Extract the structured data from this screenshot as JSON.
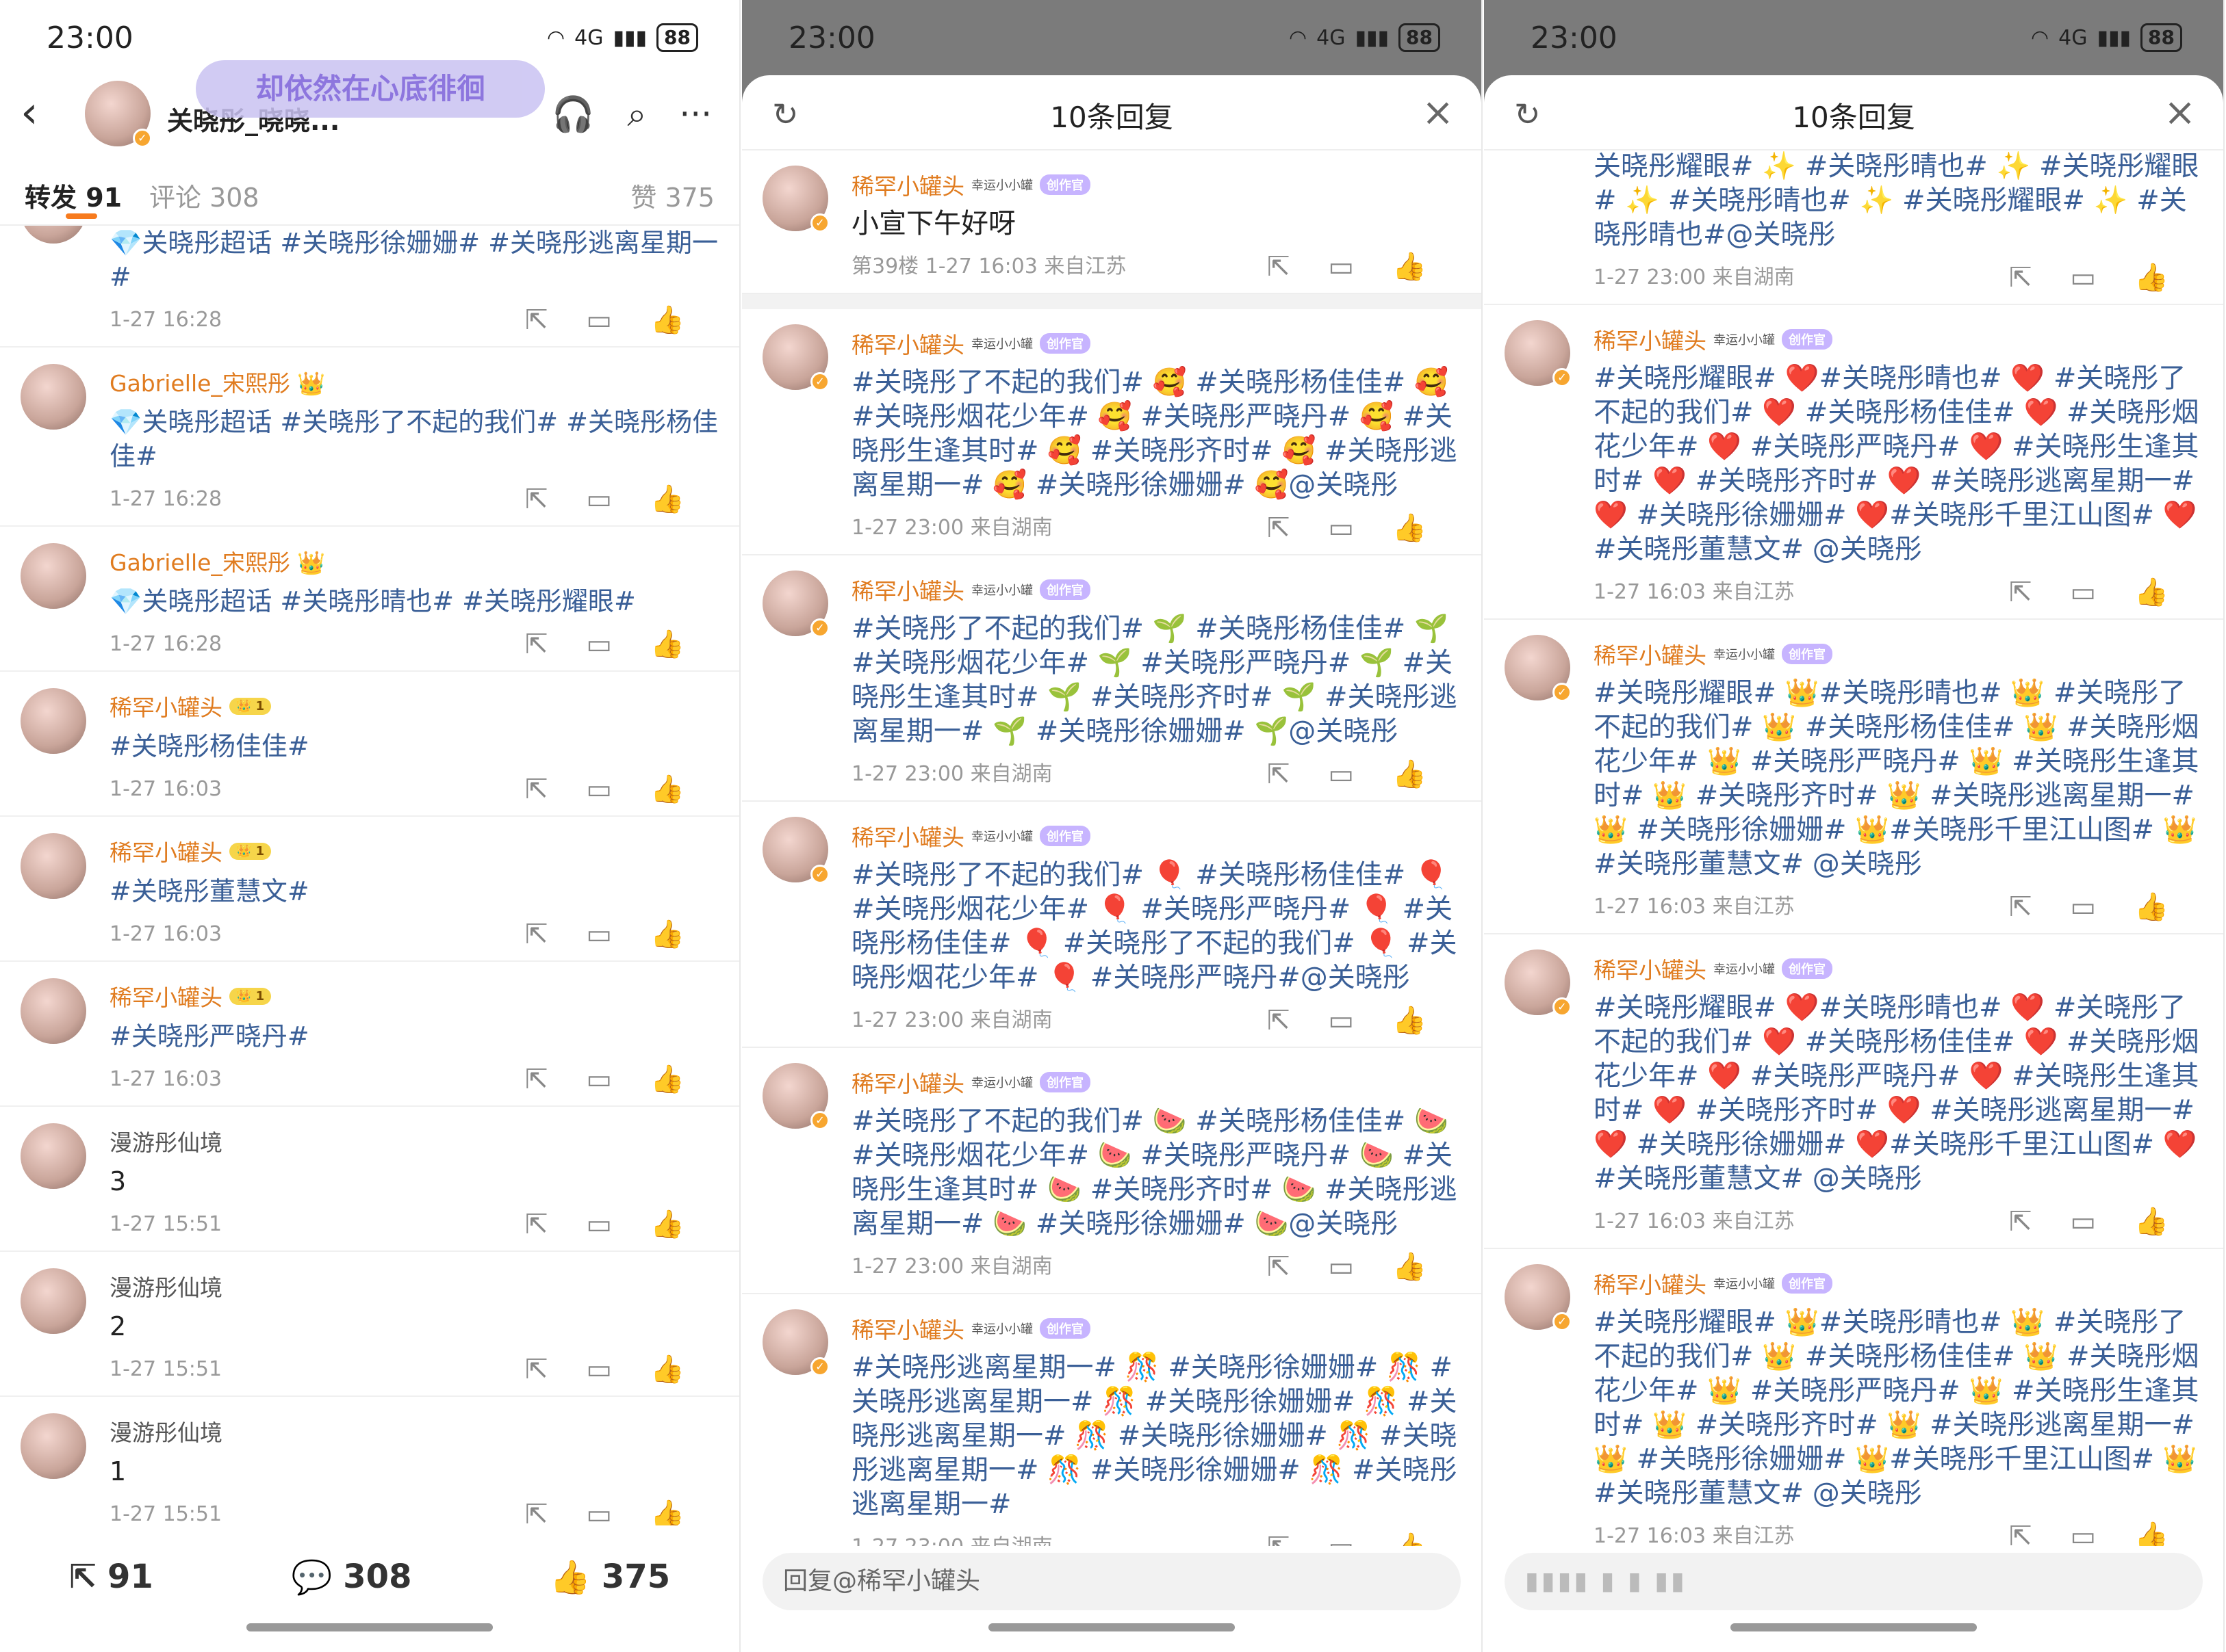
{
  "status": {
    "time": "23:00",
    "network": "4G",
    "battery": "88"
  },
  "panel1": {
    "user_name": "关晓彤_晓晓...",
    "song": "却依然在心底徘徊",
    "tabs": [
      {
        "label": "转发 91"
      },
      {
        "label": "评论 308"
      },
      {
        "label": "赞 375"
      }
    ],
    "items": [
      {
        "name": "",
        "text": "💎关晓彤超话 #关晓彤徐姗姗# #关晓彤逃离星期一#",
        "time": "1-27 16:28"
      },
      {
        "name": "Gabrielle_宋熙彤 👑",
        "text": "💎关晓彤超话 #关晓彤了不起的我们# #关晓彤杨佳佳#",
        "time": "1-27 16:28"
      },
      {
        "name": "Gabrielle_宋熙彤 👑",
        "text": "💎关晓彤超话 #关晓彤晴也# #关晓彤耀眼#",
        "time": "1-27 16:28"
      },
      {
        "name": "稀罕小罐头",
        "text": "#关晓彤杨佳佳#",
        "time": "1-27 16:03"
      },
      {
        "name": "稀罕小罐头",
        "text": "#关晓彤董慧文#",
        "time": "1-27 16:03"
      },
      {
        "name": "稀罕小罐头",
        "text": "#关晓彤严晓丹#",
        "time": "1-27 16:03"
      },
      {
        "name": "漫游彤仙境",
        "text": "3",
        "time": "1-27 15:51"
      },
      {
        "name": "漫游彤仙境",
        "text": "2",
        "time": "1-27 15:51"
      },
      {
        "name": "漫游彤仙境",
        "text": "1",
        "time": "1-27 15:51"
      }
    ],
    "bottom": {
      "repost": "91",
      "comment": "308",
      "like": "375"
    }
  },
  "panel2": {
    "title": "10条回复",
    "badge_lucky": "幸运小小罐",
    "badge_creator": "创作官",
    "first": {
      "name": "稀罕小罐头",
      "text": "小宣下午好呀",
      "meta": "第39楼 1-27 16:03 来自江苏"
    },
    "replies": [
      {
        "name": "稀罕小罐头",
        "text": "#关晓彤了不起的我们# 🥰 #关晓彤杨佳佳# 🥰 #关晓彤烟花少年# 🥰 #关晓彤严晓丹# 🥰 #关晓彤生逢其时# 🥰 #关晓彤齐时# 🥰 #关晓彤逃离星期一# 🥰 #关晓彤徐姗姗# 🥰@关晓彤",
        "meta": "1-27 23:00 来自湖南"
      },
      {
        "name": "稀罕小罐头",
        "text": "#关晓彤了不起的我们# 🌱 #关晓彤杨佳佳# 🌱 #关晓彤烟花少年# 🌱 #关晓彤严晓丹# 🌱 #关晓彤生逢其时# 🌱 #关晓彤齐时# 🌱 #关晓彤逃离星期一# 🌱 #关晓彤徐姗姗# 🌱@关晓彤",
        "meta": "1-27 23:00 来自湖南"
      },
      {
        "name": "稀罕小罐头",
        "text": "#关晓彤了不起的我们# 🎈 #关晓彤杨佳佳# 🎈 #关晓彤烟花少年# 🎈 #关晓彤严晓丹# 🎈 #关晓彤杨佳佳# 🎈 #关晓彤了不起的我们# 🎈 #关晓彤烟花少年# 🎈 #关晓彤严晓丹#@关晓彤",
        "meta": "1-27 23:00 来自湖南"
      },
      {
        "name": "稀罕小罐头",
        "text": "#关晓彤了不起的我们# 🍉 #关晓彤杨佳佳# 🍉 #关晓彤烟花少年# 🍉 #关晓彤严晓丹# 🍉 #关晓彤生逢其时# 🍉 #关晓彤齐时# 🍉 #关晓彤逃离星期一# 🍉 #关晓彤徐姗姗# 🍉@关晓彤",
        "meta": "1-27 23:00 来自湖南"
      },
      {
        "name": "稀罕小罐头",
        "text": "#关晓彤逃离星期一# 🎊 #关晓彤徐姗姗# 🎊 #关晓彤逃离星期一# 🎊 #关晓彤徐姗姗# 🎊 #关晓彤逃离星期一# 🎊 #关晓彤徐姗姗# 🎊 #关晓彤逃离星期一# 🎊 #关晓彤徐姗姗# 🎊 #关晓彤逃离星期一#",
        "meta": "1-27 23:00 来自湖南"
      }
    ],
    "input": "回复@稀罕小罐头"
  },
  "panel3": {
    "title": "10条回复",
    "top_text": "关晓彤耀眼# ✨ #关晓彤晴也# ✨ #关晓彤耀眼# ✨ #关晓彤晴也# ✨ #关晓彤耀眼# ✨ #关晓彤晴也#@关晓彤",
    "top_meta": "1-27 23:00 来自湖南",
    "replies": [
      {
        "name": "稀罕小罐头",
        "text": "#关晓彤耀眼# ❤️#关晓彤晴也# ❤️ #关晓彤了不起的我们# ❤️ #关晓彤杨佳佳# ❤️ #关晓彤烟花少年# ❤️ #关晓彤严晓丹# ❤️ #关晓彤生逢其时# ❤️ #关晓彤齐时# ❤️ #关晓彤逃离星期一# ❤️ #关晓彤徐姗姗# ❤️#关晓彤千里江山图# ❤️#关晓彤董慧文# @关晓彤",
        "meta": "1-27 16:03 来自江苏"
      },
      {
        "name": "稀罕小罐头",
        "text": "#关晓彤耀眼# 👑#关晓彤晴也# 👑 #关晓彤了不起的我们# 👑 #关晓彤杨佳佳# 👑 #关晓彤烟花少年# 👑 #关晓彤严晓丹# 👑 #关晓彤生逢其时# 👑 #关晓彤齐时# 👑 #关晓彤逃离星期一# 👑 #关晓彤徐姗姗# 👑#关晓彤千里江山图# 👑#关晓彤董慧文# @关晓彤",
        "meta": "1-27 16:03 来自江苏"
      },
      {
        "name": "稀罕小罐头",
        "text": "#关晓彤耀眼# ❤️#关晓彤晴也# ❤️ #关晓彤了不起的我们# ❤️ #关晓彤杨佳佳# ❤️ #关晓彤烟花少年# ❤️ #关晓彤严晓丹# ❤️ #关晓彤生逢其时# ❤️ #关晓彤齐时# ❤️ #关晓彤逃离星期一# ❤️ #关晓彤徐姗姗# ❤️#关晓彤千里江山图# ❤️#关晓彤董慧文# @关晓彤",
        "meta": "1-27 16:03 来自江苏"
      },
      {
        "name": "稀罕小罐头",
        "text": "#关晓彤耀眼# 👑#关晓彤晴也# 👑 #关晓彤了不起的我们# 👑 #关晓彤杨佳佳# 👑 #关晓彤烟花少年# 👑 #关晓彤严晓丹# 👑 #关晓彤生逢其时# 👑 #关晓彤齐时# 👑 #关晓彤逃离星期一# 👑 #关晓彤徐姗姗# 👑#关晓彤千里江山图# 👑#关晓彤董慧文# @关晓彤",
        "meta": "1-27 16:03 来自江苏"
      }
    ]
  }
}
